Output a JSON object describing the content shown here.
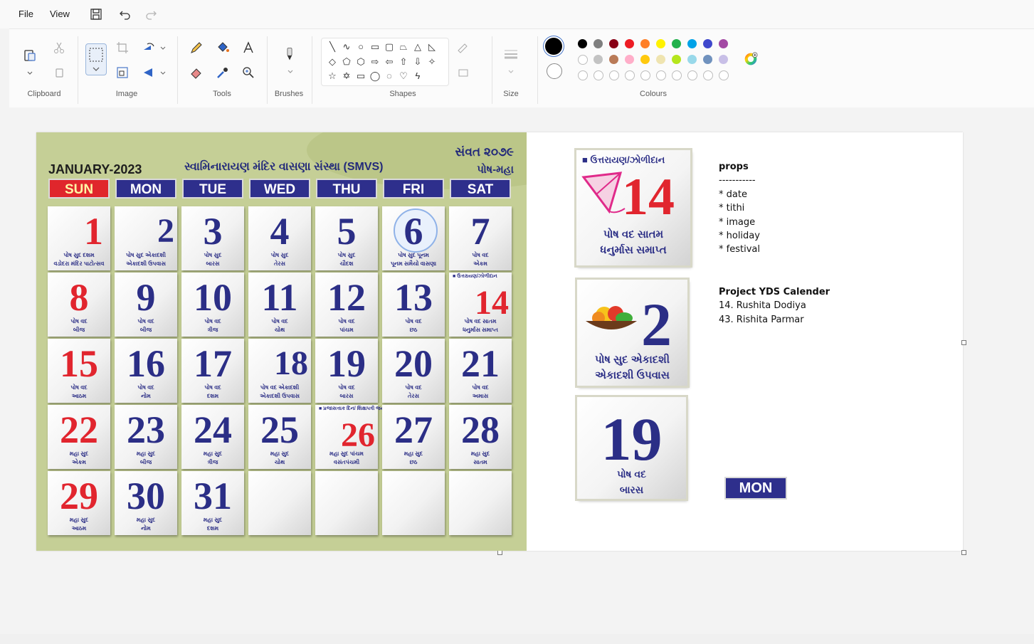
{
  "menu": {
    "file": "File",
    "view": "View"
  },
  "ribbon": {
    "groups": {
      "clipboard": "Clipboard",
      "image": "Image",
      "tools": "Tools",
      "brushes": "Brushes",
      "shapes": "Shapes",
      "size": "Size",
      "colours": "Colours"
    },
    "current_colours": {
      "primary": "#000000",
      "secondary": "#ffffff"
    },
    "palette_row1": [
      "#000000",
      "#7f7f7f",
      "#880015",
      "#ed1c24",
      "#ff7f27",
      "#fff200",
      "#22b14c",
      "#00a2e8",
      "#3f48cc",
      "#a349a4"
    ],
    "palette_row2": [
      "#ffffff",
      "#c3c3c3",
      "#b97a57",
      "#ffaec9",
      "#ffc90e",
      "#efe4b0",
      "#b5e61d",
      "#99d9ea",
      "#7092be",
      "#c8bfe7"
    ],
    "palette_row3_empty": 10
  },
  "calendar": {
    "month": "JANUARY-2023",
    "org": "સ્વામિનારાયણ મંદિર વાસણા સંસ્થા (SMVS)",
    "samvat": "સંવત ૨૦૭૯",
    "masa": "પોષ-મહા",
    "days": [
      "SUN",
      "MON",
      "TUE",
      "WED",
      "THU",
      "FRI",
      "SAT"
    ],
    "cells": [
      {
        "n": "1",
        "t1": "પોષ સુદ દશમ",
        "t2": "વડોદરા મંદિર પાટોત્સવ",
        "red": true
      },
      {
        "n": "2",
        "t1": "પોષ સુદ એકાદશી",
        "t2": "એકાદશી ઉપવાસ"
      },
      {
        "n": "3",
        "t1": "પોષ સુદ",
        "t2": "બારસ"
      },
      {
        "n": "4",
        "t1": "પોષ સુદ",
        "t2": "તેરસ"
      },
      {
        "n": "5",
        "t1": "પોષ સુદ",
        "t2": "ચૌદશ"
      },
      {
        "n": "6",
        "t1": "પોષ સુદ પૂનમ",
        "t2": "પૂનમ સમૈયો વાસણા"
      },
      {
        "n": "7",
        "t1": "પોષ વદ",
        "t2": "એકમ"
      },
      {
        "n": "8",
        "t1": "પોષ વદ",
        "t2": "બીજ",
        "red": true
      },
      {
        "n": "9",
        "t1": "પોષ વદ",
        "t2": "બીજ"
      },
      {
        "n": "10",
        "t1": "પોષ વદ",
        "t2": "ત્રીજ"
      },
      {
        "n": "11",
        "t1": "પોષ વદ",
        "t2": "ચોથ"
      },
      {
        "n": "12",
        "t1": "પોષ વદ",
        "t2": "પાંચમ"
      },
      {
        "n": "13",
        "t1": "પોષ વદ",
        "t2": "છઠ"
      },
      {
        "n": "14",
        "t1": "પોષ વદ સાતમ",
        "t2": "ધનુર્માસ સમાપ્ત",
        "red": true,
        "tag": "■ ઉત્તરાયણ/ઝોળીદાન"
      },
      {
        "n": "15",
        "t1": "પોષ વદ",
        "t2": "આઠમ",
        "red": true
      },
      {
        "n": "16",
        "t1": "પોષ વદ",
        "t2": "નોમ"
      },
      {
        "n": "17",
        "t1": "પોષ વદ",
        "t2": "દશમ"
      },
      {
        "n": "18",
        "t1": "પોષ વદ એકાદશી",
        "t2": "એકાદશી ઉપવાસ"
      },
      {
        "n": "19",
        "t1": "પોષ વદ",
        "t2": "બારસ"
      },
      {
        "n": "20",
        "t1": "પોષ વદ",
        "t2": "તેરસ"
      },
      {
        "n": "21",
        "t1": "પોષ વદ",
        "t2": "અમાસ"
      },
      {
        "n": "22",
        "t1": "મહા સુદ",
        "t2": "એકમ",
        "red": true
      },
      {
        "n": "23",
        "t1": "મહા સુદ",
        "t2": "બીજ"
      },
      {
        "n": "24",
        "t1": "મહા સુદ",
        "t2": "ત્રીજ"
      },
      {
        "n": "25",
        "t1": "મહા સુદ",
        "t2": "ચોથ"
      },
      {
        "n": "26",
        "t1": "મહા સુદ પાંચમ",
        "t2": "વસંતપંચમી",
        "red": true,
        "tag": "■ પ્રજાસત્તાક દિન/ શિક્ષાપત્રી જયંતી"
      },
      {
        "n": "27",
        "t1": "મહા સુદ",
        "t2": "છઠ"
      },
      {
        "n": "28",
        "t1": "મહા સુદ",
        "t2": "સાતમ"
      },
      {
        "n": "29",
        "t1": "મહા સુદ",
        "t2": "આઠમ",
        "red": true
      },
      {
        "n": "30",
        "t1": "મહા સુદ",
        "t2": "નોમ"
      },
      {
        "n": "31",
        "t1": "મહા સુદ",
        "t2": "દશમ"
      },
      {
        "n": "",
        "t1": "",
        "t2": ""
      },
      {
        "n": "",
        "t1": "",
        "t2": ""
      },
      {
        "n": "",
        "t1": "",
        "t2": ""
      },
      {
        "n": "",
        "t1": "",
        "t2": ""
      }
    ]
  },
  "clips": {
    "c14": {
      "tag": "■ ઉત્તરાયણ/ઝોળીદાન",
      "num": "14",
      "l1": "પોષ વદ સાતમ",
      "l2": "ધનુર્માસ સમાપ્ત"
    },
    "c2": {
      "num": "2",
      "l1": "પોષ સુદ એકાદશી",
      "l2": "એકાદશી ઉપવાસ"
    },
    "c19": {
      "num": "19",
      "l1": "પોષ વદ",
      "l2": "બારસ"
    },
    "mon": "MON"
  },
  "notes": {
    "props_title": "props",
    "divider": "-----------",
    "props": [
      "* date",
      "* tithi",
      "* image",
      "* holiday",
      "* festival"
    ],
    "project_title": "Project YDS Calender",
    "members": [
      "14. Rushita Dodiya",
      "43. Rishita Parmar"
    ]
  }
}
